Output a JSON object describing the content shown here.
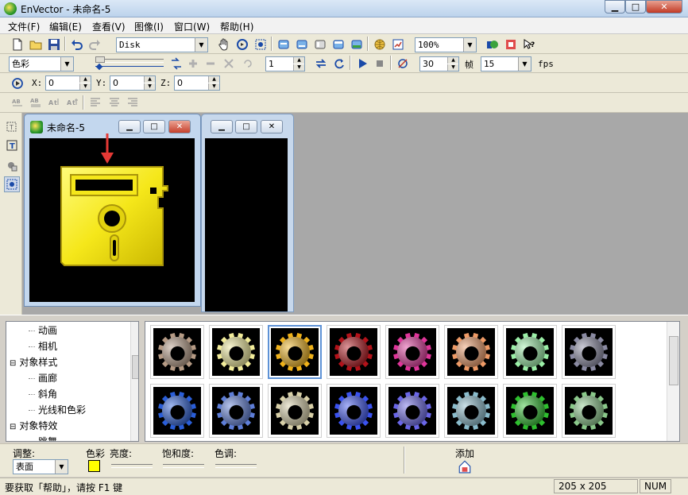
{
  "window": {
    "title": "EnVector - 未命名-5",
    "min_label": "▁",
    "max_label": "□",
    "close_label": "✕"
  },
  "menu": [
    "文件(F)",
    "编辑(E)",
    "查看(V)",
    "图像(I)",
    "窗口(W)",
    "帮助(H)"
  ],
  "toolbar1": {
    "shape_select": "Disk",
    "zoom_select": "100%"
  },
  "toolbar2": {
    "color_mode": "色彩",
    "frame_value": "1",
    "speed_value": "30",
    "frame_label": "帧",
    "fps_select": "15",
    "fps_label": "fps"
  },
  "toolbar3": {
    "x_label": "X:",
    "x_value": "0",
    "y_label": "Y:",
    "y_value": "0",
    "z_label": "Z:",
    "z_value": "0"
  },
  "document": {
    "title": "未命名-5"
  },
  "tree": {
    "items": [
      {
        "label": "动画",
        "level": 2
      },
      {
        "label": "相机",
        "level": 2
      },
      {
        "label": "对象样式",
        "level": 1,
        "expander": "⊟"
      },
      {
        "label": "画廊",
        "level": 2
      },
      {
        "label": "斜角",
        "level": 2
      },
      {
        "label": "光线和色彩",
        "level": 2
      },
      {
        "label": "对象特效",
        "level": 1,
        "expander": "⊟"
      },
      {
        "label": "跳舞",
        "level": 2
      }
    ]
  },
  "gallery": {
    "gear_colors": [
      "#b59a84",
      "#f2ec9a",
      "#f0b21a",
      "#b3121a",
      "#e0359a",
      "#ee9a66",
      "#9cf0a8",
      "#8a8aa2",
      "#2a5ed8",
      "#5e7ed8",
      "#d8d0a8",
      "#3a52f0",
      "#6a66e8",
      "#8abccc",
      "#2ec02e",
      "#8ac88a"
    ],
    "selected_index": 2
  },
  "adjust": {
    "adjust_label": "调整:",
    "adjust_select": "表面",
    "color_label": "色彩",
    "brightness_label": "亮度:",
    "saturation_label": "饱和度:",
    "hue_label": "色调:",
    "add_label": "添加",
    "swatch_color": "#ffff00"
  },
  "status": {
    "help_text": "要获取「帮助」，请按 F1 键",
    "size_text": "205 x 205",
    "num_text": "NUM"
  },
  "colors": {
    "disk_yellow": "#f5e71a",
    "arrow_red": "#e53935"
  }
}
